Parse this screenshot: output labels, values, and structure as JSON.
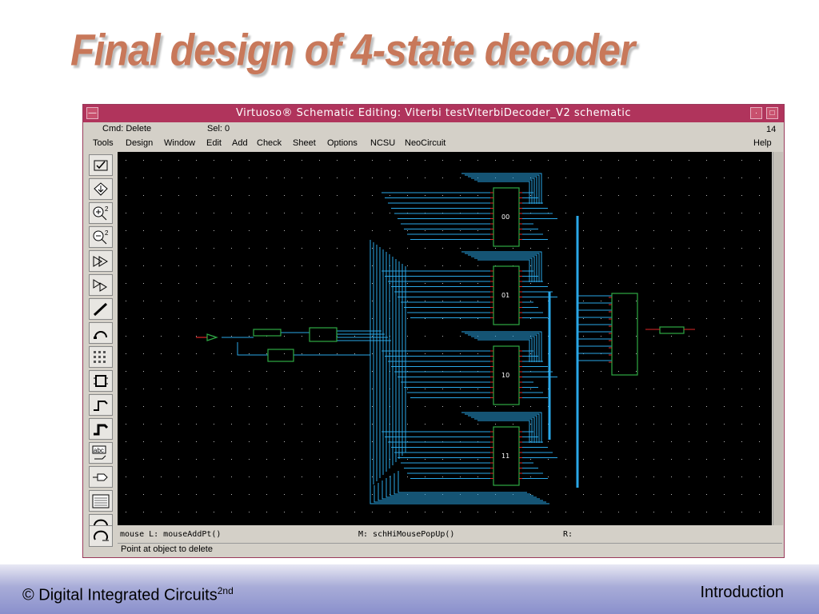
{
  "slide": {
    "title": "Final design of 4-state decoder",
    "footer_left": "© Digital Integrated Circuits",
    "footer_left_sup": "2nd",
    "footer_right": "Introduction"
  },
  "window": {
    "title": "Virtuoso® Schematic Editing: Viterbi testViterbiDecoder_V2 schematic",
    "cmd": "Cmd: Delete",
    "sel": "Sel: 0",
    "number": "14",
    "menu": [
      "Tools",
      "Design",
      "Window",
      "Edit",
      "Add",
      "Check",
      "Sheet",
      "Options",
      "NCSU",
      "NeoCircuit"
    ],
    "help": "Help"
  },
  "toolbar": {
    "tools": [
      "check-save-icon",
      "save-icon",
      "zoom-in-icon",
      "zoom-out-icon",
      "stretch-icon",
      "copy-icon",
      "wire-icon",
      "undo-icon",
      "instance-grid-icon",
      "instance-icon",
      "wire-narrow-icon",
      "wire-wide-icon",
      "label-icon",
      "pin-icon",
      "property-icon",
      "redraw-icon"
    ]
  },
  "schematic": {
    "blocks": [
      "00",
      "01",
      "10",
      "11"
    ]
  },
  "status": {
    "mouse_l": "mouse L: mouseAddPt()",
    "mouse_m": "M: schHiMousePopUp()",
    "mouse_r": "R:",
    "prompt": "Point at object to delete"
  }
}
